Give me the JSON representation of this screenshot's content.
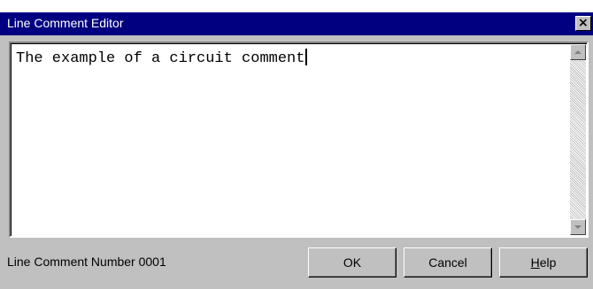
{
  "window": {
    "title": "Line Comment Editor",
    "close_glyph": "×"
  },
  "editor": {
    "text": "The example of a circuit comment"
  },
  "status": {
    "text": "Line Comment Number 0001"
  },
  "buttons": {
    "ok": "OK",
    "cancel": "Cancel",
    "help_mnemonic": "H",
    "help_rest": "elp"
  },
  "icons": {
    "close": "close-icon",
    "scroll_up": "scroll-up-arrow-icon",
    "scroll_down": "scroll-down-arrow-icon"
  },
  "colors": {
    "titlebar": "#000080",
    "dialog_face": "#c0c0c0",
    "editor_bg": "#ffffff"
  }
}
